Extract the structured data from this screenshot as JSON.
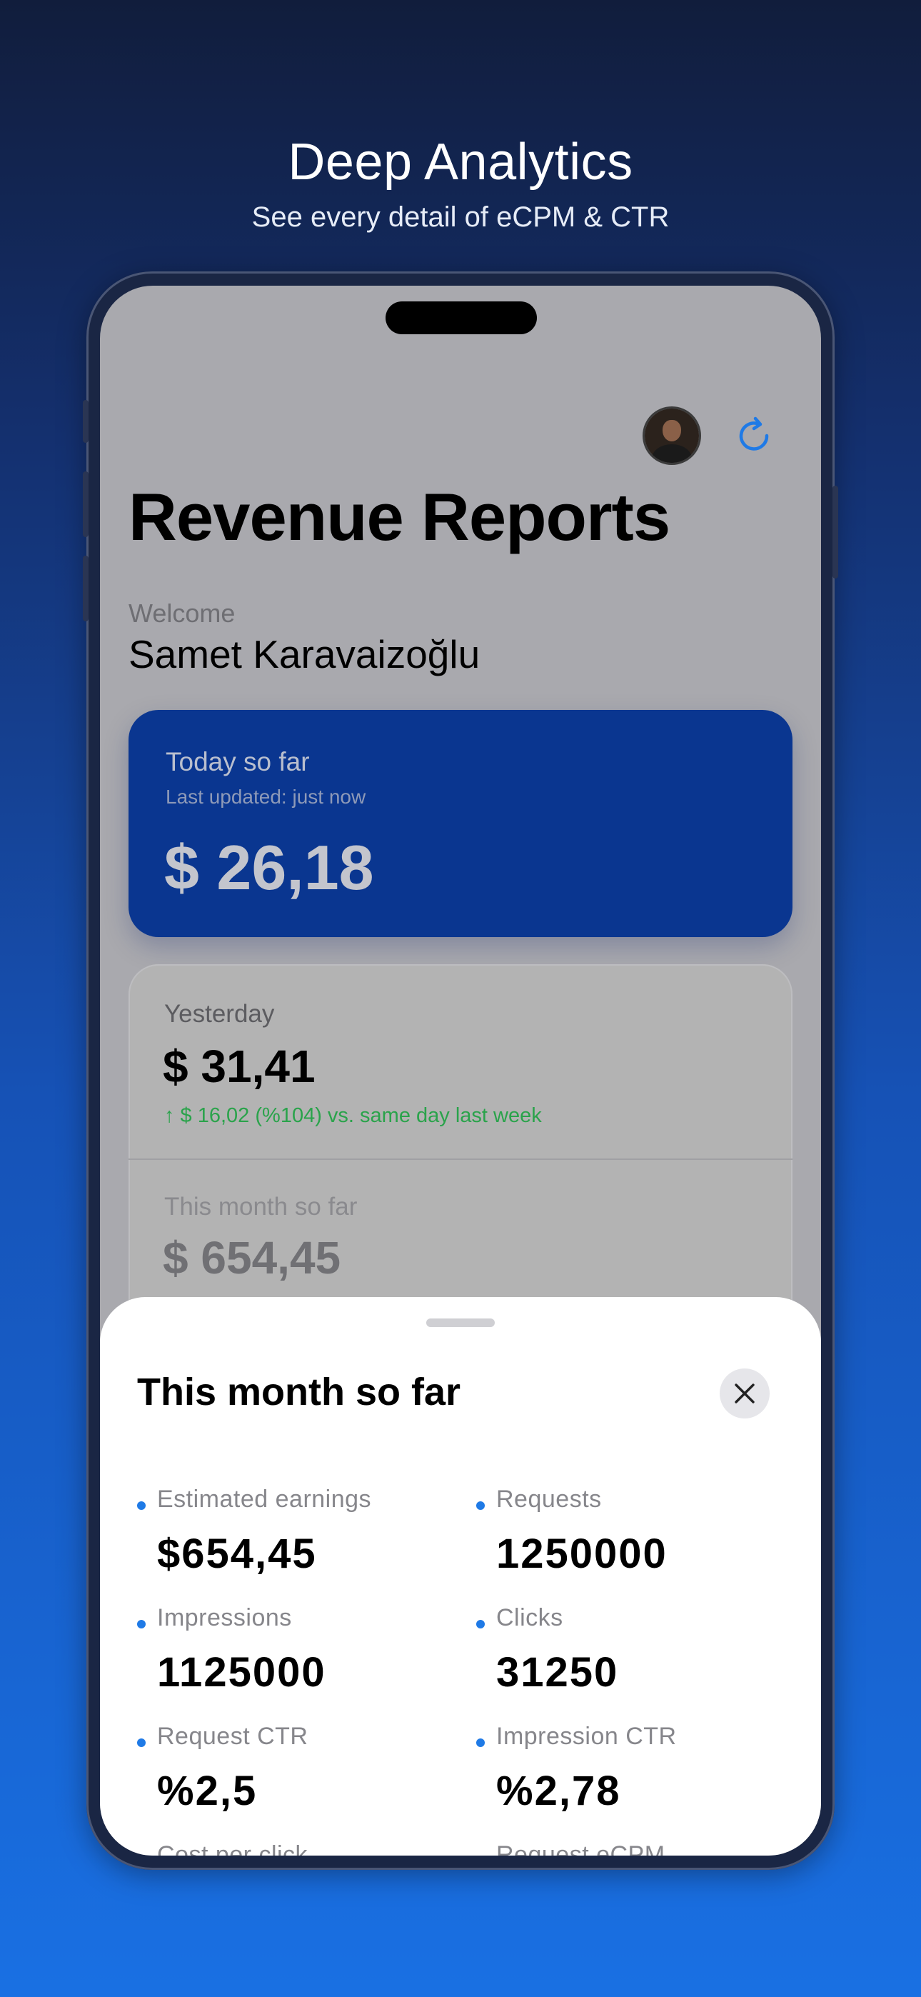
{
  "promo": {
    "title": "Deep Analytics",
    "subtitle": "See every detail of eCPM & CTR"
  },
  "header": {
    "avatar_icon": "user-avatar",
    "refresh_icon": "refresh-icon",
    "title": "Revenue Reports"
  },
  "welcome": {
    "label": "Welcome",
    "name": "Samet Karavaizoğlu"
  },
  "today": {
    "title": "Today so far",
    "updated": "Last updated: just now",
    "amount": "$ 26,18"
  },
  "yesterday": {
    "label": "Yesterday",
    "amount": "$ 31,41",
    "change": "↑ $ 16,02 (%104) vs. same day last week"
  },
  "month": {
    "label": "This month so far",
    "amount": "$ 654,45"
  },
  "sheet": {
    "title": "This month so far",
    "close_icon": "close-icon",
    "metrics": [
      {
        "label": "Estimated earnings",
        "value": "$654,45"
      },
      {
        "label": "Requests",
        "value": "1250000"
      },
      {
        "label": "Impressions",
        "value": "1125000"
      },
      {
        "label": "Clicks",
        "value": "31250"
      },
      {
        "label": "Request CTR",
        "value": "%2,5"
      },
      {
        "label": "Impression CTR",
        "value": "%2,78"
      },
      {
        "label": "Cost per click",
        "value": ""
      },
      {
        "label": "Request eCPM",
        "value": ""
      }
    ]
  },
  "colors": {
    "accent": "#1f7ae6",
    "today_card": "#0a3690",
    "positive": "#2aa34b"
  }
}
